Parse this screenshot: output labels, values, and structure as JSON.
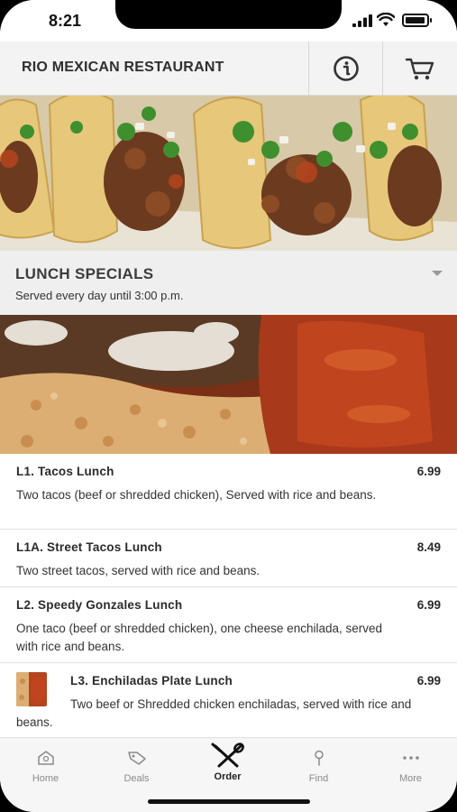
{
  "status_bar": {
    "time": "8:21"
  },
  "header": {
    "title": "RIO MEXICAN RESTAURANT",
    "info_icon": "info-circle-icon",
    "cart_icon": "cart-icon"
  },
  "section": {
    "title": "LUNCH SPECIALS",
    "subtitle": "Served every day until 3:00 p.m."
  },
  "menu": {
    "items": [
      {
        "name": "L1. Tacos Lunch",
        "price": "6.99",
        "desc": "Two tacos (beef or shredded chicken), Served with rice and beans."
      },
      {
        "name": "L1A. Street Tacos Lunch",
        "price": "8.49",
        "desc": "Two street tacos, served with rice and beans."
      },
      {
        "name": "L2. Speedy Gonzales Lunch",
        "price": "6.99",
        "desc": "One taco (beef or shredded chicken), one cheese enchilada, served with rice and beans."
      },
      {
        "name": "L3. Enchiladas Plate Lunch",
        "price": "6.99",
        "desc": "Two beef or Shredded chicken enchiladas, served with rice and beans."
      }
    ]
  },
  "tabs": [
    {
      "label": "Home",
      "icon": "home-icon"
    },
    {
      "label": "Deals",
      "icon": "tag-icon"
    },
    {
      "label": "Order",
      "icon": "utensils-icon"
    },
    {
      "label": "Find",
      "icon": "pin-icon"
    },
    {
      "label": "More",
      "icon": "more-dots-icon"
    }
  ],
  "colors": {
    "header_bg": "#f3f3f3",
    "section_bg": "#efefef",
    "active_tab": "#222222",
    "inactive_tab": "#8a8a8a"
  }
}
